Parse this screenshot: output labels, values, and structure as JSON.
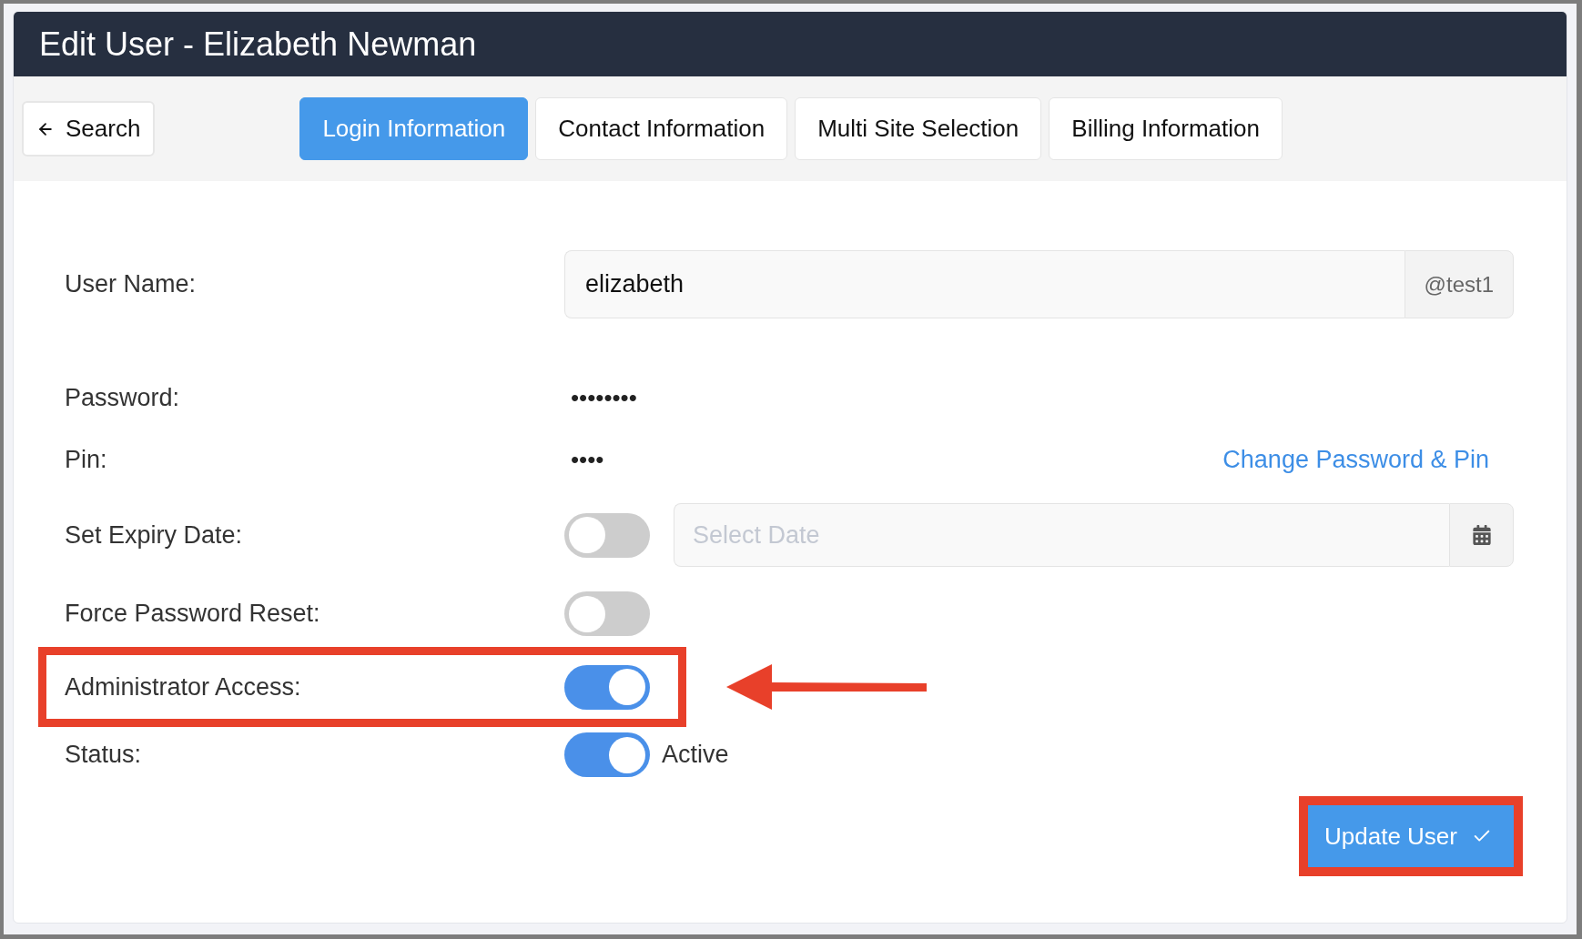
{
  "window": {
    "title": "Edit User - Elizabeth Newman"
  },
  "back_button": {
    "label": "Search"
  },
  "tabs": [
    {
      "label": "Login Information",
      "selected": true
    },
    {
      "label": "Contact Information",
      "selected": false
    },
    {
      "label": "Multi Site Selection",
      "selected": false
    },
    {
      "label": "Billing Information",
      "selected": false
    }
  ],
  "fields": [
    {
      "kind": "input",
      "label": "User Name:",
      "value": "elizabeth",
      "suffix": "@test1"
    },
    {
      "kind": "masked",
      "label": "Password:",
      "value": "••••••••"
    },
    {
      "kind": "masked",
      "label": "Pin:",
      "value": "••••",
      "link": "Change Password & Pin"
    },
    {
      "kind": "toggle_date",
      "label": "Set Expiry Date:",
      "on": false,
      "placeholder": "Select Date"
    },
    {
      "kind": "toggle",
      "label": "Force Password Reset:",
      "on": false
    },
    {
      "kind": "toggle",
      "label": "Administrator Access:",
      "on": true,
      "highlighted": true,
      "arrow": true
    },
    {
      "kind": "toggle",
      "label": "Status:",
      "on": true,
      "caption": "Active"
    }
  ],
  "submit": {
    "label": "Update User",
    "highlighted": true
  }
}
